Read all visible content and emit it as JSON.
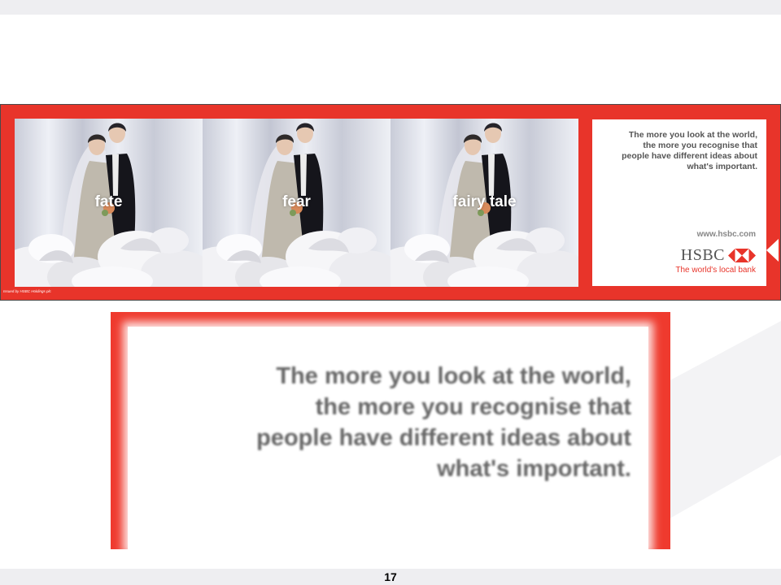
{
  "banner": {
    "photos": [
      {
        "word": "fate"
      },
      {
        "word": "fear"
      },
      {
        "word": "fairy tale"
      }
    ],
    "ad_lines": [
      "The more you look at the world,",
      "the more you recognise that",
      "people have different ideas about",
      "what's important."
    ],
    "url": "www.hsbc.com",
    "logo_text": "HSBC",
    "tagline": "The world's local bank",
    "issued_note": "Issued by HSBC Holdings plc"
  },
  "zoom": {
    "lines": [
      "The more you look at the world,",
      "the more you recognise that",
      "people have different ideas about",
      "what's important."
    ]
  },
  "footer": {
    "page_number": "17"
  },
  "colors": {
    "brand_red": "#e8342a",
    "text_grey": "#555555",
    "band_grey": "#eeeef1"
  },
  "icons": [
    "hsbc-hexagon-logo-icon",
    "bride-groom-figurine-image"
  ]
}
